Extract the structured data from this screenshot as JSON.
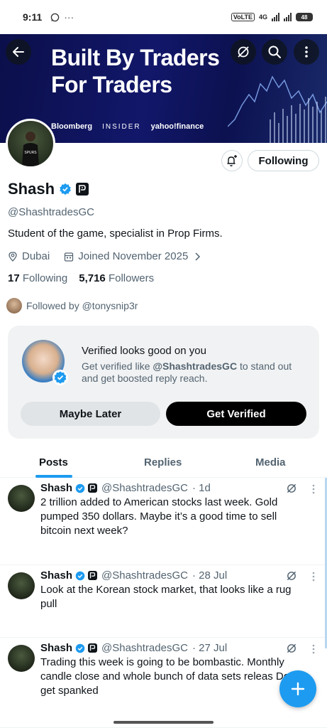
{
  "status_bar": {
    "time": "9:11",
    "dots": "···",
    "volte": "VoLTE",
    "net": "4G",
    "battery": "48"
  },
  "banner": {
    "headline_line1": "Built By Traders",
    "headline_line2": "For Traders",
    "logos": [
      "Bloomberg",
      "INSIDER",
      "yahoo!finance"
    ]
  },
  "profile": {
    "name": "Shash",
    "handle": "@ShashtradesGC",
    "bio": "Student of the game, specialist in Prop Firms.",
    "location": "Dubai",
    "joined": "Joined November 2025",
    "following_count": "17",
    "following_label": "Following",
    "followers_count": "5,716",
    "followers_label": "Followers",
    "followed_by": "Followed by @tonysnip3r",
    "follow_button": "Following"
  },
  "verify_card": {
    "title": "Verified looks good on you",
    "body_prefix": "Get verified like ",
    "body_handle": "@ShashtradesGC",
    "body_suffix": " to stand out and get boosted reply reach.",
    "later_label": "Maybe Later",
    "verify_label": "Get Verified"
  },
  "tabs": [
    "Posts",
    "Replies",
    "Media"
  ],
  "posts": [
    {
      "name": "Shash",
      "handle": "@ShashtradesGC",
      "time": "· 1d",
      "text": "2 trillion added to American stocks last week. Gold pumped 350 dollars. Maybe it’s a good time to sell bitcoin next week?"
    },
    {
      "name": "Shash",
      "handle": "@ShashtradesGC",
      "time": "· 28 Jul",
      "text": "Look at the Korean stock market, that looks like a rug pull"
    },
    {
      "name": "Shash",
      "handle": "@ShashtradesGC",
      "time": "· 27 Jul",
      "text": "Trading this week is going to be bombastic. Monthly candle close and whole bunch of data sets releas Don’t get spanked"
    }
  ],
  "colors": {
    "accent": "#1d9bf0",
    "text": "#0f1419",
    "secondary": "#536471",
    "banner": "#0b0f4a"
  },
  "icons": [
    "back-arrow-icon",
    "grok-icon",
    "search-icon",
    "more-vertical-icon",
    "bell-plus-icon",
    "verified-badge-icon",
    "affiliate-badge-icon",
    "location-icon",
    "calendar-icon",
    "chevron-right-icon",
    "compose-plus-icon"
  ]
}
